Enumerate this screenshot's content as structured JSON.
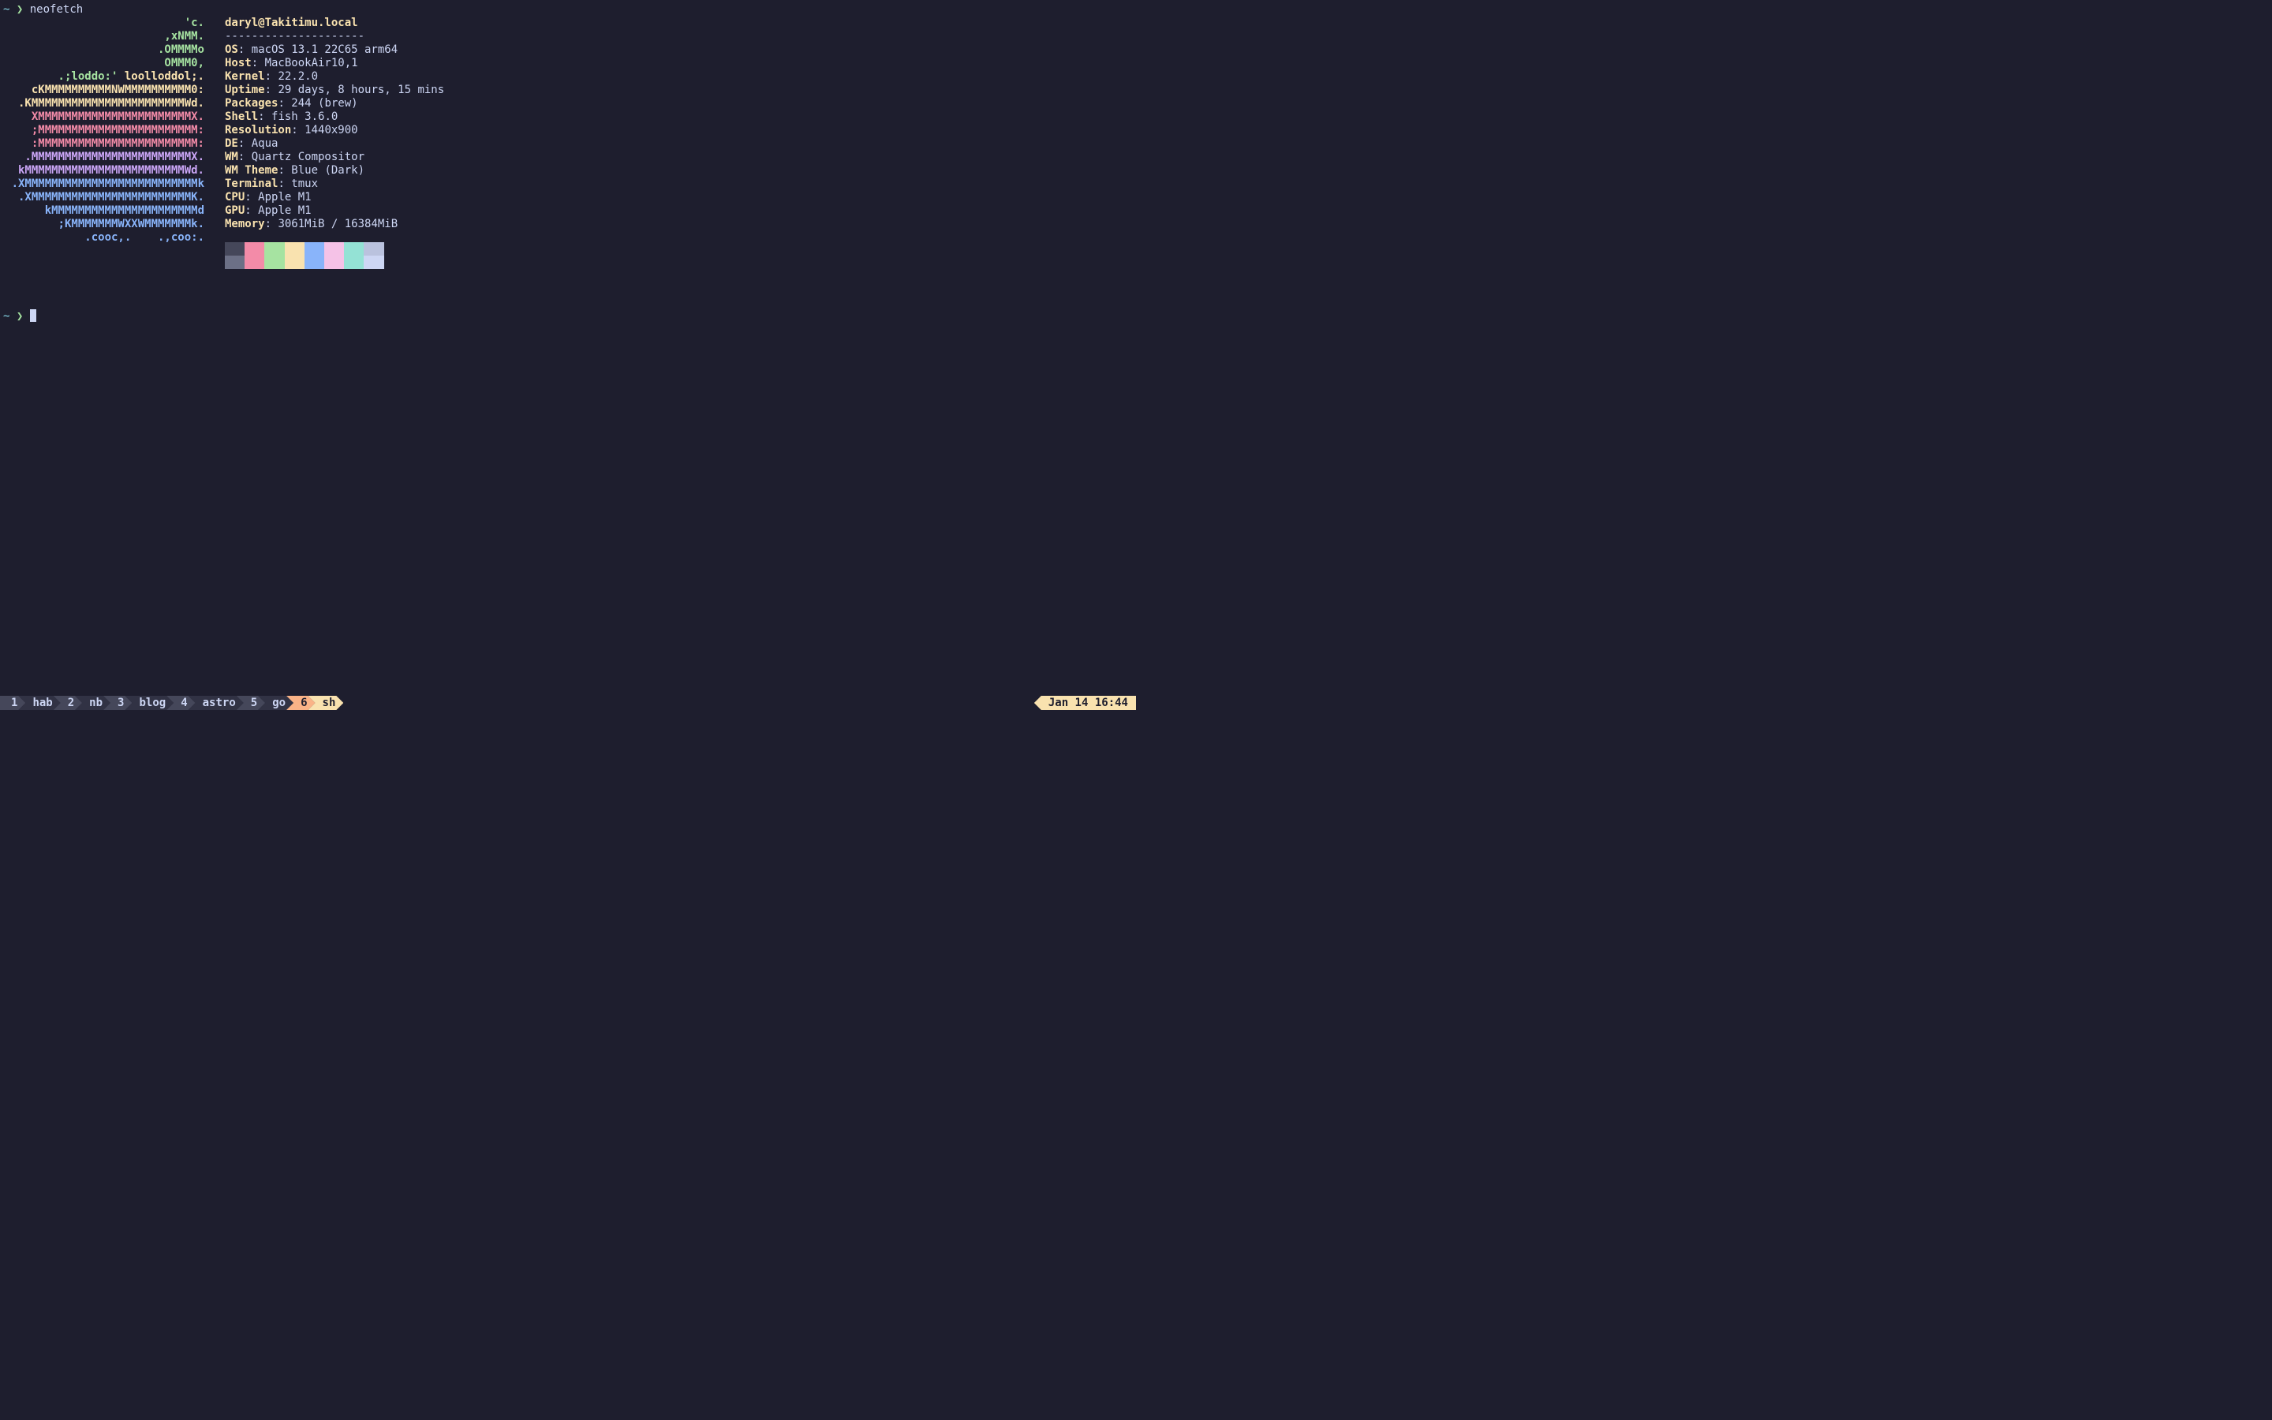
{
  "prompt": {
    "tilde": "~",
    "arrow": "❯",
    "command": "neofetch"
  },
  "ascii": {
    "l01": "'c.",
    "l02": ",xNMM.",
    "l03": ".OMMMMo",
    "l04": "OMMM0,",
    "l05a": ".;loddo:' ",
    "l05b": "loolloddol;.",
    "l06": "cKMMMMMMMMMMNWMMMMMMMMMM0:",
    "l07a": ".KMMMMMMMMMMMMMMMMMMMMMMMWd.",
    "l08a": "XMMMMMMMMMMMMMMMMMMMMMMMX.",
    "l09": ";MMMMMMMMMMMMMMMMMMMMMMMM:",
    "l10": ":MMMMMMMMMMMMMMMMMMMMMMMM:",
    "l11": ".MMMMMMMMMMMMMMMMMMMMMMMMX.",
    "l12": "kMMMMMMMMMMMMMMMMMMMMMMMMWd.",
    "l13": ".XMMMMMMMMMMMMMMMMMMMMMMMMMMk",
    "l14": ".XMMMMMMMMMMMMMMMMMMMMMMMMK.",
    "l15": "kMMMMMMMMMMMMMMMMMMMMMMd",
    "l16": ";KMMMMMMMWXXWMMMMMMMk.",
    "l17": ".cooc,.    .,coo:."
  },
  "header": {
    "userhost": "daryl@Takitimu.local",
    "divider": "---------------------"
  },
  "info": {
    "os_k": "OS",
    "os_v": "macOS 13.1 22C65 arm64",
    "host_k": "Host",
    "host_v": "MacBookAir10,1",
    "kernel_k": "Kernel",
    "kernel_v": "22.2.0",
    "uptime_k": "Uptime",
    "uptime_v": "29 days, 8 hours, 15 mins",
    "packages_k": "Packages",
    "packages_v": "244 (brew)",
    "shell_k": "Shell",
    "shell_v": "fish 3.6.0",
    "resolution_k": "Resolution",
    "resolution_v": "1440x900",
    "de_k": "DE",
    "de_v": "Aqua",
    "wm_k": "WM",
    "wm_v": "Quartz Compositor",
    "wmtheme_k": "WM Theme",
    "wmtheme_v": "Blue (Dark)",
    "terminal_k": "Terminal",
    "terminal_v": "tmux",
    "cpu_k": "CPU",
    "cpu_v": "Apple M1",
    "gpu_k": "GPU",
    "gpu_v": "Apple M1",
    "memory_k": "Memory",
    "memory_v": "3061MiB / 16384MiB"
  },
  "colors": {
    "row": [
      "#45475a",
      "#6c7086",
      "#f38ba8",
      "#a6e3a1",
      "#f9e2af",
      "#89b4fa",
      "#f5c2e7",
      "#94e2d5",
      "#bac2de"
    ]
  },
  "tabs": [
    {
      "n": "1",
      "name": "hab",
      "active": false
    },
    {
      "n": "2",
      "name": "nb",
      "active": false
    },
    {
      "n": "3",
      "name": "blog",
      "active": false
    },
    {
      "n": "4",
      "name": "astro",
      "active": false
    },
    {
      "n": "5",
      "name": "go",
      "active": false
    },
    {
      "n": "6",
      "name": "sh",
      "active": true
    }
  ],
  "clock": "Jan 14 16:44"
}
